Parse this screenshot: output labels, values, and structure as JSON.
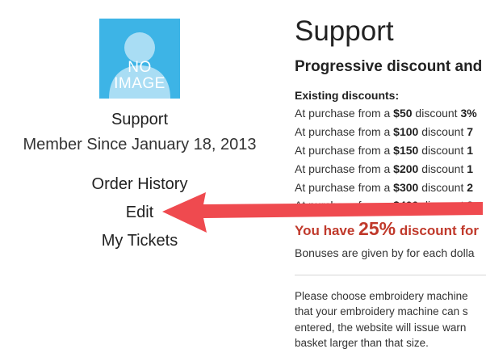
{
  "profile": {
    "avatar_placeholder_line1": "NO",
    "avatar_placeholder_line2": "IMAGE",
    "name": "Support",
    "member_since": "Member Since January 18, 2013"
  },
  "menu": {
    "order_history": "Order History",
    "edit": "Edit",
    "my_tickets": "My Tickets"
  },
  "content": {
    "page_title": "Support",
    "section_title": "Progressive discount and",
    "existing_label": "Existing discounts:",
    "tiers": [
      {
        "prefix": "At purchase from a ",
        "amount": "$50",
        "mid": " discount ",
        "discount": "3%"
      },
      {
        "prefix": "At purchase from a ",
        "amount": "$100",
        "mid": " discount ",
        "discount": "7"
      },
      {
        "prefix": "At purchase from a ",
        "amount": "$150",
        "mid": " discount ",
        "discount": "1"
      },
      {
        "prefix": "At purchase from a ",
        "amount": "$200",
        "mid": " discount ",
        "discount": "1"
      },
      {
        "prefix": "At purchase from a ",
        "amount": "$300",
        "mid": " discount ",
        "discount": "2"
      },
      {
        "prefix": "At purchase from a ",
        "amount": "$400",
        "mid": " discount ",
        "discount": "2"
      }
    ],
    "bonus_prefix": "You have ",
    "bonus_value": "25%",
    "bonus_suffix": " discount for",
    "bonus_note": "Bonuses are given by for each dolla",
    "paragraph_lines": [
      "Please choose embroidery machine",
      "that your embroidery  machine can s",
      "entered, the website will issue warn",
      "basket larger than that size."
    ]
  },
  "colors": {
    "avatar_bg": "#3db4e6",
    "arrow": "#ef4a4f",
    "bonus_text": "#c0392b"
  },
  "annotations": {
    "arrow_icon": "red-arrow-pointing-left"
  }
}
